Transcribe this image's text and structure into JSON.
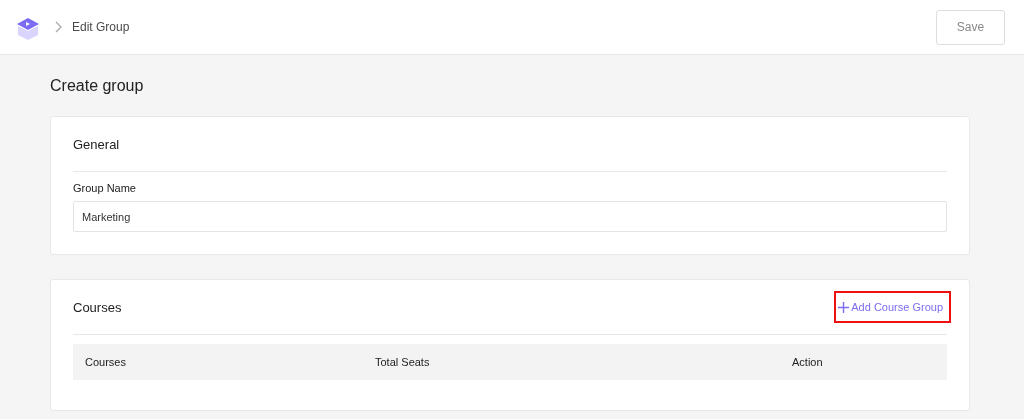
{
  "header": {
    "breadcrumb": "Edit Group",
    "save_button": "Save"
  },
  "page_title": "Create group",
  "general": {
    "title": "General",
    "field_label": "Group Name",
    "field_value": "Marketing"
  },
  "courses": {
    "title": "Courses",
    "add_button": {
      "label": "Add Course Group",
      "highlighted": true
    },
    "columns": [
      "Courses",
      "Total Seats",
      "Action"
    ]
  }
}
